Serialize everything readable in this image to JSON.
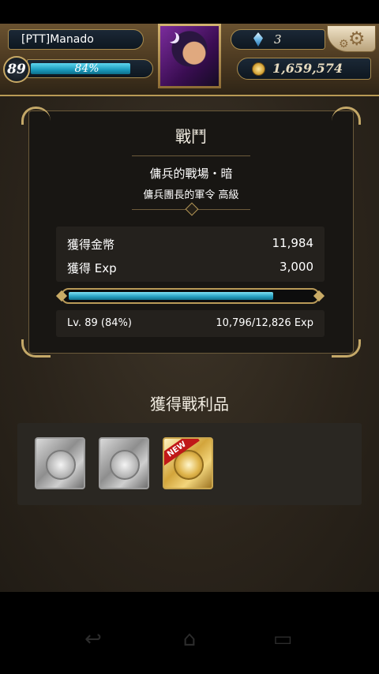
{
  "header": {
    "player_name": "[PTT]Manado",
    "level": "89",
    "exp_percent_label": "84%",
    "exp_fraction": 0.84,
    "gems": "3",
    "coins": "1,659,574"
  },
  "battle": {
    "title": "戰鬥",
    "stage": "傭兵的戰場・暗",
    "quest": "傭兵團長的軍令 高級",
    "rewards": [
      {
        "label": "獲得金幣",
        "value": "11,984"
      },
      {
        "label": "獲得 Exp",
        "value": "3,000"
      }
    ],
    "exp_bar_fraction": 0.84,
    "level_text": "Lv. 89 (84%)",
    "exp_text": "10,796/12,826 Exp"
  },
  "loot": {
    "title": "獲得戰利品",
    "new_label": "NEW",
    "items": [
      {
        "kind": "silver-coin-card"
      },
      {
        "kind": "silver-coin-card"
      },
      {
        "kind": "gold-coin-card",
        "is_new": true
      }
    ]
  },
  "icons": {
    "gem": "blue-gem-icon",
    "coin": "gold-coin-icon",
    "settings": "gear-icon",
    "nav": [
      "back-icon",
      "home-icon",
      "recent-apps-icon"
    ]
  },
  "colors": {
    "exp_bar": "#2aa3c4",
    "gold_frame": "#c4a868",
    "new_badge": "#c01818"
  }
}
